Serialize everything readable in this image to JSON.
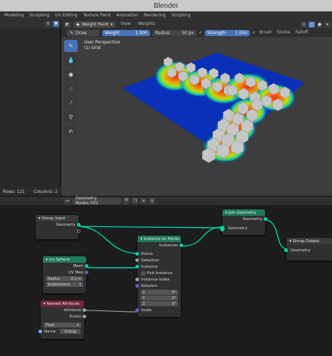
{
  "title": "Blender",
  "workspaces": [
    "Modeling",
    "Sculpting",
    "UV Editing",
    "Texture Paint",
    "Animation",
    "Rendering",
    "Scripting"
  ],
  "active_workspace_index": -1,
  "viewport": {
    "mode": "Weight Paint",
    "menus": [
      "View",
      "Weights"
    ],
    "brush_name": "Draw",
    "weight_label": "Weight",
    "weight_value": "1.000",
    "radius_label": "Radius",
    "radius_value": "50 px",
    "strength_label": "Strength",
    "strength_value": "1.000",
    "brush_menu": "Brush",
    "stroke_menu": "Stroke",
    "falloff_menu": "Falloff",
    "view_name": "User Perspective",
    "object_name": "(1) Grid"
  },
  "spreadsheet": {
    "rows": "Rows: 121",
    "columns": "Columns: 2"
  },
  "node_editor": {
    "tree_name": "Geometry Nodes.001",
    "nodes": {
      "group_input": {
        "title": "Group Input",
        "geometry": "Geometry"
      },
      "join_geometry": {
        "title": "Join Geometry",
        "geometry_out": "Geometry",
        "geometry_in": "Geometry"
      },
      "group_output": {
        "title": "Group Output",
        "geometry": "Geometry"
      },
      "instance_on_points": {
        "title": "Instance on Points",
        "instances": "Instances",
        "points": "Points",
        "selection": "Selection",
        "instance": "Instance",
        "pick_instance": "Pick Instance",
        "instance_index": "Instance Index",
        "rotation": "Rotation",
        "x_label": "X",
        "x_val": "0°",
        "y_label": "Y",
        "y_val": "0°",
        "z_label": "Z",
        "z_val": "0°",
        "scale": "Scale"
      },
      "ico_sphere": {
        "title": "Ico Sphere",
        "mesh": "Mesh",
        "uv_map": "UV Map",
        "radius_label": "Radius",
        "radius_value": "0.1 m",
        "subdiv_label": "Subdivisions",
        "subdiv_value": "1"
      },
      "named_attribute": {
        "title": "Named Attribute",
        "attribute": "Attribute",
        "exists": "Exists",
        "type": "Float",
        "name_label": "Name",
        "name_value": "Group"
      }
    }
  },
  "colors": {
    "accent": "#4772b3",
    "geometry_socket": "#00d6a3",
    "vector_socket": "#6363c7",
    "float_socket": "#a1a1a1",
    "geometry_header": "#1f7a5c",
    "input_header": "#742438"
  }
}
